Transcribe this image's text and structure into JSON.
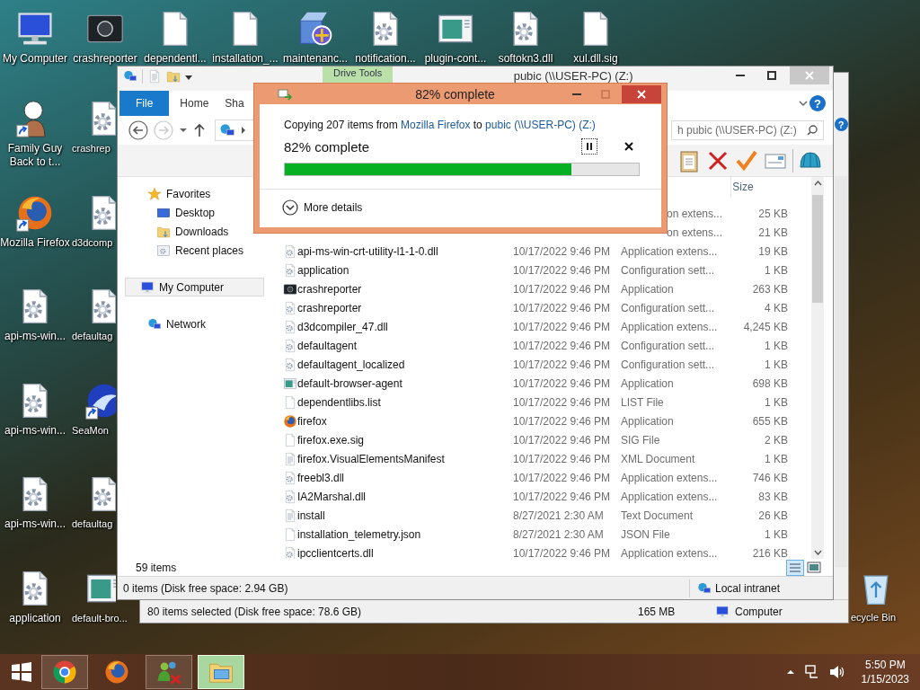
{
  "desktop": {
    "top_row": [
      {
        "kind": "computer",
        "label": "My Computer",
        "shortcut": false
      },
      {
        "kind": "app-dark",
        "label": "crashreporter",
        "shortcut": false
      },
      {
        "kind": "blank-file",
        "label": "dependentl...",
        "shortcut": false
      },
      {
        "kind": "blank-file",
        "label": "installation_...",
        "shortcut": false
      },
      {
        "kind": "installer",
        "label": "maintenanc...",
        "shortcut": false
      },
      {
        "kind": "gear-file",
        "label": "notification...",
        "shortcut": false
      },
      {
        "kind": "window-file",
        "label": "plugin-cont...",
        "shortcut": false
      },
      {
        "kind": "gear-file",
        "label": "softokn3.dll",
        "shortcut": false
      },
      {
        "kind": "blank-file",
        "label": "xul.dll.sig",
        "shortcut": false
      }
    ],
    "column_1": [
      {
        "kind": "cartoon",
        "label": "Family Guy Back to t...",
        "shortcut": true
      },
      {
        "kind": "firefox",
        "label": "Mozilla Firefox",
        "shortcut": true
      },
      {
        "kind": "gear-file",
        "label": "api-ms-win...",
        "shortcut": false
      },
      {
        "kind": "gear-file",
        "label": "api-ms-win...",
        "shortcut": false
      },
      {
        "kind": "gear-file",
        "label": "api-ms-win...",
        "shortcut": false
      },
      {
        "kind": "gear-file",
        "label": "application",
        "shortcut": false
      }
    ],
    "column_2": [
      {
        "kind": "gear-file",
        "label": "crashrep",
        "shortcut": false
      },
      {
        "kind": "gear-file",
        "label": "d3dcomp",
        "shortcut": false
      },
      {
        "kind": "gear-file",
        "label": "defaultag",
        "shortcut": false
      },
      {
        "kind": "seamonkey",
        "label": "SeaMon",
        "shortcut": true
      },
      {
        "kind": "gear-file",
        "label": "defaultag",
        "shortcut": false
      },
      {
        "kind": "window-file",
        "label": "default-bro...",
        "shortcut": false
      }
    ],
    "right": [
      {
        "kind": "recycle",
        "label": "ecycle Bin",
        "shortcut": false
      }
    ]
  },
  "explorer_back": {
    "help_label": "?",
    "status_bar": {
      "selection": "80 items selected (Disk free space: 78.6 GB)",
      "size": "165 MB",
      "zone": "Computer"
    }
  },
  "explorer": {
    "title": "pubic (\\\\USER-PC) (Z:)",
    "contextual_tab": "Drive Tools",
    "ribbon_tabs": [
      {
        "label": "File",
        "kind": "menu"
      },
      {
        "label": "Home",
        "kind": "tab"
      },
      {
        "label": "Sha",
        "kind": "tab"
      }
    ],
    "help_label": "?",
    "search": {
      "placeholder": "h pubic (\\\\USER-PC) (Z:)"
    },
    "navigation": [
      {
        "label": "Favorites",
        "kind": "star",
        "selected": false,
        "children": [
          {
            "label": "Desktop",
            "kind": "desktop",
            "selected": false
          },
          {
            "label": "Downloads",
            "kind": "downloads",
            "selected": false
          },
          {
            "label": "Recent places",
            "kind": "recent",
            "selected": false
          }
        ]
      },
      {
        "label": "My Computer",
        "kind": "computer",
        "selected": true
      },
      {
        "label": "Network",
        "kind": "network",
        "selected": false
      }
    ],
    "columns": [
      "Size"
    ],
    "files": [
      {
        "type": "on extens...",
        "size": "25 KB"
      },
      {
        "type": "on extens...",
        "size": "21 KB"
      },
      {
        "kind": "dll",
        "name": "api-ms-win-crt-utility-l1-1-0.dll",
        "date": "10/17/2022 9:46 PM",
        "type": "Application extens...",
        "size": "19 KB"
      },
      {
        "kind": "config",
        "name": "application",
        "date": "10/17/2022 9:46 PM",
        "type": "Configuration sett...",
        "size": "1 KB"
      },
      {
        "kind": "app-dark",
        "name": "crashreporter",
        "date": "10/17/2022 9:46 PM",
        "type": "Application",
        "size": "263 KB"
      },
      {
        "kind": "config",
        "name": "crashreporter",
        "date": "10/17/2022 9:46 PM",
        "type": "Configuration sett...",
        "size": "4 KB"
      },
      {
        "kind": "dll",
        "name": "d3dcompiler_47.dll",
        "date": "10/17/2022 9:46 PM",
        "type": "Application extens...",
        "size": "4,245 KB"
      },
      {
        "kind": "config",
        "name": "defaultagent",
        "date": "10/17/2022 9:46 PM",
        "type": "Configuration sett...",
        "size": "1 KB"
      },
      {
        "kind": "config",
        "name": "defaultagent_localized",
        "date": "10/17/2022 9:46 PM",
        "type": "Configuration sett...",
        "size": "1 KB"
      },
      {
        "kind": "app-window",
        "name": "default-browser-agent",
        "date": "10/17/2022 9:46 PM",
        "type": "Application",
        "size": "698 KB"
      },
      {
        "kind": "blank",
        "name": "dependentlibs.list",
        "date": "10/17/2022 9:46 PM",
        "type": "LIST File",
        "size": "1 KB"
      },
      {
        "kind": "firefox",
        "name": "firefox",
        "date": "10/17/2022 9:46 PM",
        "type": "Application",
        "size": "655 KB"
      },
      {
        "kind": "blank",
        "name": "firefox.exe.sig",
        "date": "10/17/2022 9:46 PM",
        "type": "SIG File",
        "size": "2 KB"
      },
      {
        "kind": "xml",
        "name": "firefox.VisualElementsManifest",
        "date": "10/17/2022 9:46 PM",
        "type": "XML Document",
        "size": "1 KB"
      },
      {
        "kind": "dll",
        "name": "freebl3.dll",
        "date": "10/17/2022 9:46 PM",
        "type": "Application extens...",
        "size": "746 KB"
      },
      {
        "kind": "dll",
        "name": "IA2Marshal.dll",
        "date": "10/17/2022 9:46 PM",
        "type": "Application extens...",
        "size": "83 KB"
      },
      {
        "kind": "text",
        "name": "install",
        "date": "8/27/2021 2:30 AM",
        "type": "Text Document",
        "size": "26 KB"
      },
      {
        "kind": "blank",
        "name": "installation_telemetry.json",
        "date": "8/27/2021 2:30 AM",
        "type": "JSON File",
        "size": "1 KB"
      },
      {
        "kind": "dll",
        "name": "ipcclientcerts.dll",
        "date": "10/17/2022 9:46 PM",
        "type": "Application extens...",
        "size": "216 KB"
      }
    ],
    "item_count": "59 items",
    "status_bar": {
      "selection": "0 items (Disk free space: 2.94 GB)",
      "zone": "Local intranet"
    }
  },
  "copy_dialog": {
    "title": "82% complete",
    "message": {
      "prefix": "Copying 207 items from",
      "source": "Mozilla Firefox",
      "joiner": "to",
      "destination": "pubic (\\\\USER-PC) (Z:)"
    },
    "status": "82% complete",
    "level": 0.81,
    "paused": false,
    "details_label": "More details"
  },
  "taskbar": {
    "apps": [
      {
        "kind": "chrome",
        "running": true,
        "selected": false
      },
      {
        "kind": "firefox",
        "running": false,
        "selected": false
      },
      {
        "kind": "messenger",
        "running": true,
        "selected": false
      },
      {
        "kind": "explorer",
        "running": true,
        "selected": true
      }
    ],
    "time": "5:50 PM",
    "date": "1/15/2023"
  }
}
